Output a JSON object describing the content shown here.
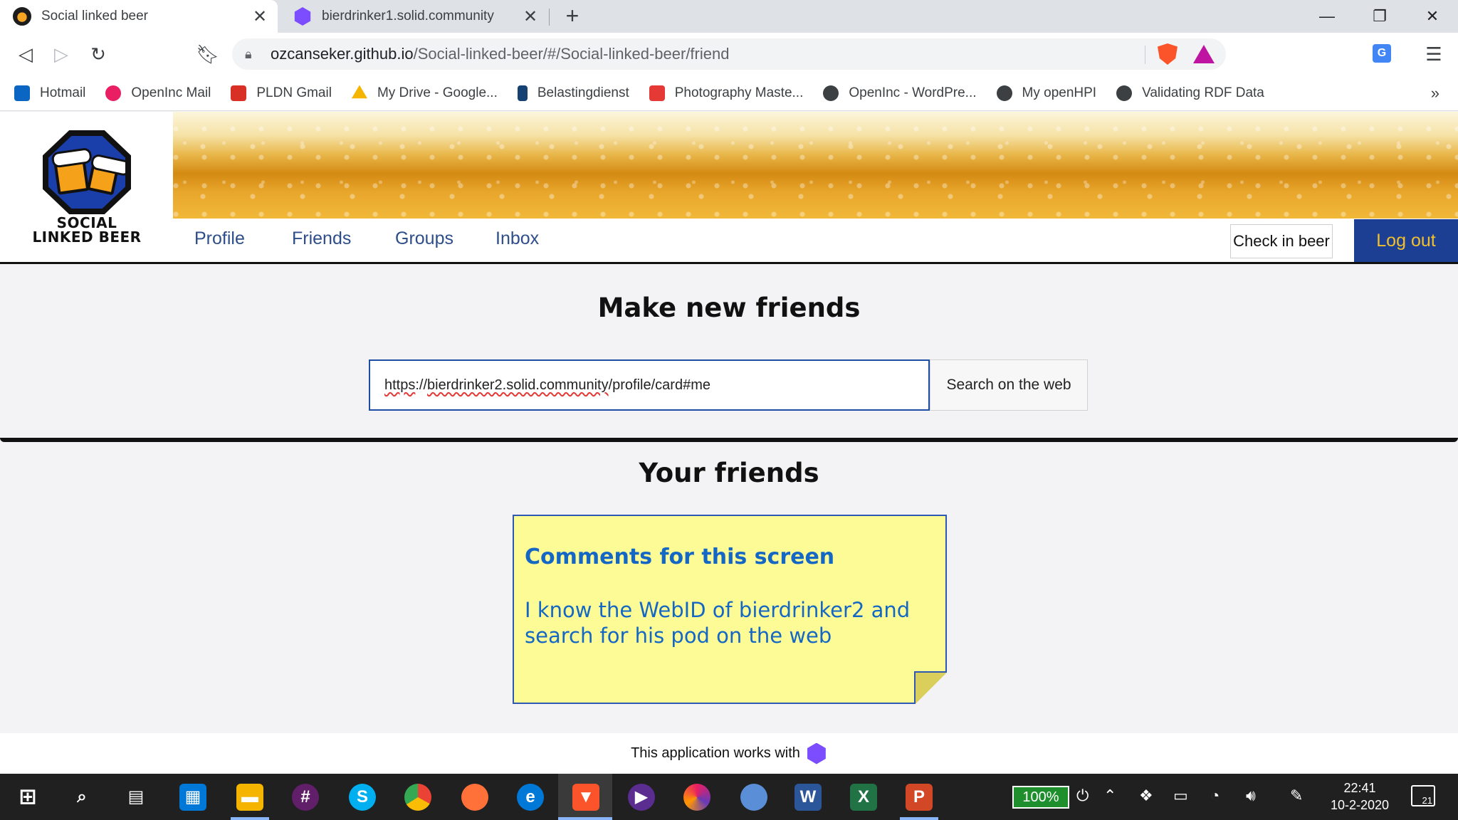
{
  "browser": {
    "tabs": [
      {
        "title": "Social linked beer",
        "active": true,
        "icon": "beer-logo-favicon"
      },
      {
        "title": "bierdrinker1.solid.community",
        "active": false,
        "icon": "solid-favicon"
      }
    ],
    "new_tab_glyph": "+",
    "window_controls": {
      "minimize": "—",
      "restore": "❐",
      "close": "✕"
    },
    "url": {
      "host": "ozcanseker.github.io",
      "path": "/Social-linked-beer/#/Social-linked-beer/friend"
    },
    "bookmarks": [
      {
        "label": "Hotmail",
        "color": "#0a66c2"
      },
      {
        "label": "OpenInc Mail",
        "color": "#e91e63"
      },
      {
        "label": "PLDN Gmail",
        "color": "#d93025"
      },
      {
        "label": "My Drive - Google...",
        "color": "#f4b400"
      },
      {
        "label": "Belastingdienst",
        "color": "#154273"
      },
      {
        "label": "Photography Maste...",
        "color": "#e53935"
      },
      {
        "label": "OpenInc - WordPre...",
        "color": "#3c4043"
      },
      {
        "label": "My openHPI",
        "color": "#3c4043"
      },
      {
        "label": "Validating RDF Data",
        "color": "#3c4043"
      }
    ],
    "bookmarks_more": "»"
  },
  "app": {
    "logo_text_line1": "SOCIAL",
    "logo_text_line2": "LINKED BEER",
    "nav": [
      "Profile",
      "Friends",
      "Groups",
      "Inbox"
    ],
    "checkin_label": "Check in beer",
    "logout_label": "Log out",
    "make_friends_title": "Make new friends",
    "search": {
      "value_part1": "https",
      "value_part2": "://",
      "value_part3": "bierdrinker2.solid.community",
      "value_part4": "/profile/card#me",
      "button_label": "Search on the web"
    },
    "your_friends_title": "Your friends",
    "note": {
      "title": "Comments for this screen",
      "body": "I know the WebID of bierdrinker2 and search for his pod on the web"
    },
    "footer_text": "This application works with"
  },
  "taskbar": {
    "battery": "100%",
    "time": "22:41",
    "date": "10-2-2020",
    "notifications": "21"
  },
  "colors": {
    "nav_link": "#2d4e8a",
    "logout_bg": "#1c3f94",
    "logout_text": "#f2c02d",
    "note_bg": "#fdfb96",
    "note_text": "#1467c4"
  }
}
